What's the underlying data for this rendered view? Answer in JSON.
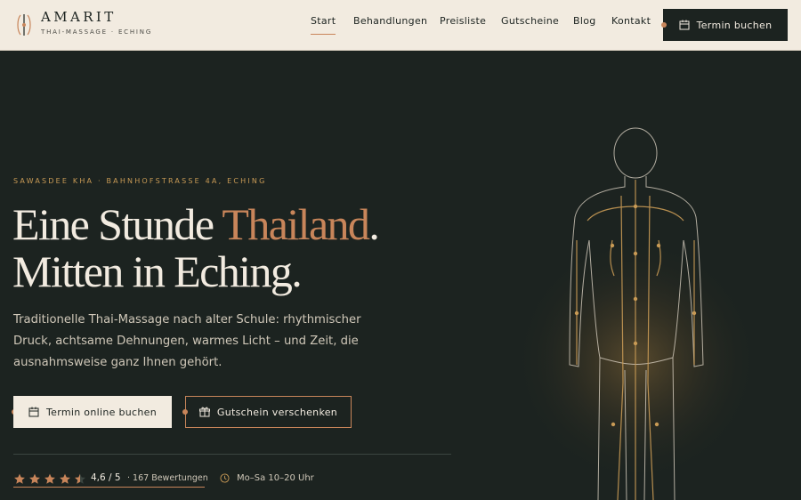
{
  "brand": {
    "name": "AMARIT",
    "subtitle": "THAI-MASSAGE · ECHING"
  },
  "nav": [
    {
      "label": "Start",
      "active": true
    },
    {
      "label": "Behandlungen",
      "active": false
    },
    {
      "label": "Preisliste",
      "active": false
    },
    {
      "label": "Gutscheine",
      "active": false
    },
    {
      "label": "Blog",
      "active": false
    },
    {
      "label": "Kontakt",
      "active": false
    }
  ],
  "header_cta": {
    "label": "Termin buchen",
    "icon": "calendar-icon"
  },
  "hero": {
    "kicker": "SAWASDEE KHA · BAHNHOFSTRASSE 4A, ECHING",
    "headline_part1": "Eine Stunde ",
    "headline_accent": "Thailand",
    "headline_part2": ".",
    "headline_line2": "Mitten in Eching.",
    "lead": "Traditionelle Thai-Massage nach alter Schule: rhythmischer Druck, achtsame Dehnungen, warmes Licht – und Zeit, die ausnahmsweise ganz Ihnen gehört.",
    "primary_cta": {
      "label": "Termin online buchen",
      "icon": "calendar-icon"
    },
    "secondary_cta": {
      "label": "Gutschein verschenken",
      "icon": "gift-icon"
    }
  },
  "rating": {
    "score_text": "4,6 / 5",
    "reviews_text": "· 167 Bewertungen",
    "stars": 4.5
  },
  "hours": {
    "text": "Mo–Sa 10–20 Uhr",
    "icon": "clock-icon"
  },
  "colors": {
    "accent": "#c8855a",
    "gold": "#c89a55",
    "dark": "#1c2320",
    "cream": "#f2ebe0"
  }
}
